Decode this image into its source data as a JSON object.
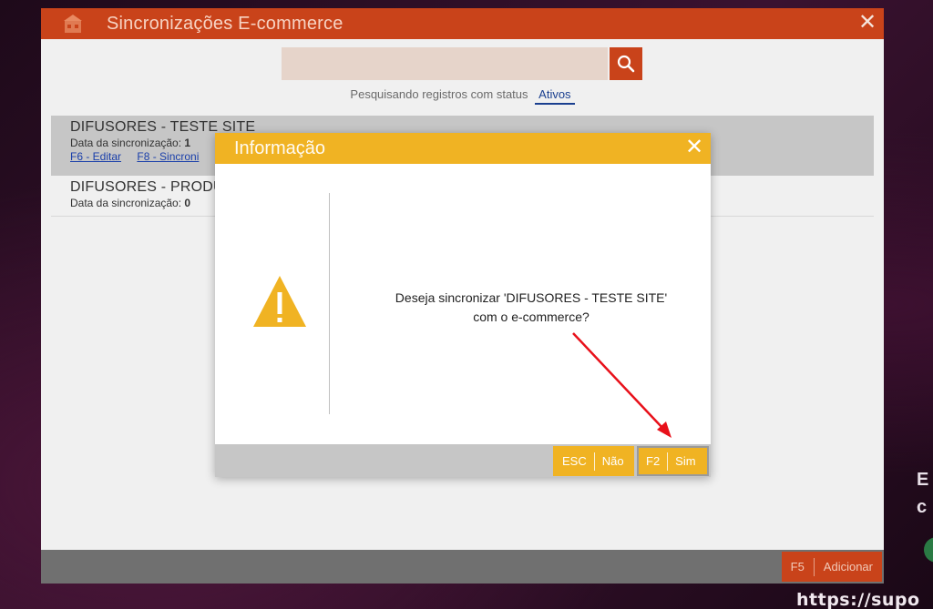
{
  "background": {
    "promo_lines": [
      "E",
      "c"
    ],
    "url": "https://supo"
  },
  "window": {
    "title": "Sincronizações E-commerce",
    "close_glyph": "✕",
    "search": {
      "value": "",
      "placeholder": ""
    },
    "status": {
      "prefix": "Pesquisando registros com status",
      "value": "Ativos"
    },
    "items": [
      {
        "name": "DIFUSORES - TESTE SITE",
        "date_label": "Data da sincronização:",
        "date_value": "1",
        "links": [
          "F6 - Editar",
          "F8 - Sincroni"
        ]
      },
      {
        "name": "DIFUSORES - PRODU",
        "date_label": "Data da sincronização:",
        "date_value": "0"
      }
    ],
    "footer": {
      "add_key": "F5",
      "add_label": "Adicionar"
    }
  },
  "dialog": {
    "title": "Informação",
    "close_glyph": "✕",
    "message_line1": "Deseja sincronizar 'DIFUSORES - TESTE SITE'",
    "message_line2": "com o e-commerce?",
    "buttons": {
      "no_key": "ESC",
      "no_label": "Não",
      "yes_key": "F2",
      "yes_label": "Sim"
    }
  },
  "colors": {
    "window_accent": "#c9431a",
    "dialog_accent": "#f0b323",
    "annotation_arrow": "#e8101a"
  }
}
